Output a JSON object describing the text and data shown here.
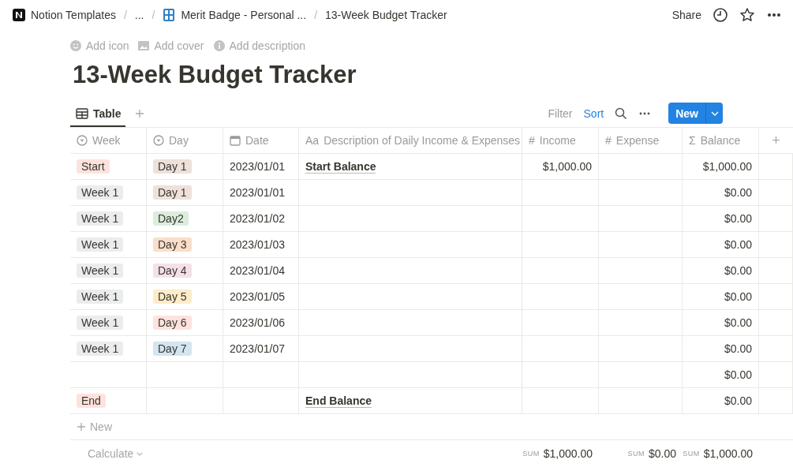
{
  "breadcrumb": {
    "separator": "/",
    "items": [
      {
        "label": "Notion Templates",
        "kind": "logo"
      },
      {
        "label": "...",
        "kind": "plain"
      },
      {
        "label": "Merit Badge - Personal ...",
        "kind": "numbers"
      },
      {
        "label": "13-Week Budget Tracker",
        "kind": "plain"
      }
    ]
  },
  "topbar": {
    "share": "Share"
  },
  "page_actions": [
    {
      "label": "Add icon",
      "kind": "smile"
    },
    {
      "label": "Add cover",
      "kind": "image"
    },
    {
      "label": "Add description",
      "kind": "info"
    }
  ],
  "title": "13-Week Budget Tracker",
  "views": [
    {
      "label": "Table",
      "selected": true
    }
  ],
  "toolbar": {
    "filter": "Filter",
    "sort": "Sort",
    "new": "New"
  },
  "table": {
    "columns": [
      {
        "label": "Week",
        "kind": "select"
      },
      {
        "label": "Day",
        "kind": "select"
      },
      {
        "label": "Date",
        "kind": "date"
      },
      {
        "label": "Description of Daily Income & Expenses",
        "kind": "title",
        "glyph": "Aa"
      },
      {
        "label": "Income",
        "kind": "number",
        "glyph": "#",
        "sum": {
          "prefix": "SUM",
          "value": "$1,000.00"
        }
      },
      {
        "label": "Expense",
        "kind": "number",
        "glyph": "#",
        "sum": {
          "prefix": "SUM",
          "value": "$0.00"
        }
      },
      {
        "label": "Balance",
        "kind": "formula",
        "glyph": "Σ",
        "sum": {
          "prefix": "SUM",
          "value": "$1,000.00"
        }
      }
    ],
    "add_column": "+",
    "rows": [
      {
        "week": {
          "label": "Start",
          "color": "#fde2dd"
        },
        "day": {
          "label": "Day 1",
          "color": "#eee0da"
        },
        "date": "2023/01/01",
        "description": "Start Balance",
        "income": "$1,000.00",
        "expense": "",
        "balance": "$1,000.00"
      },
      {
        "week": {
          "label": "Week 1",
          "color": "#ebeced"
        },
        "day": {
          "label": "Day 1",
          "color": "#eee0da"
        },
        "date": "2023/01/01",
        "description": "",
        "income": "",
        "expense": "",
        "balance": "$0.00"
      },
      {
        "week": {
          "label": "Week 1",
          "color": "#ebeced"
        },
        "day": {
          "label": "Day2",
          "color": "#dbeddb"
        },
        "date": "2023/01/02",
        "description": "",
        "income": "",
        "expense": "",
        "balance": "$0.00"
      },
      {
        "week": {
          "label": "Week 1",
          "color": "#ebeced"
        },
        "day": {
          "label": "Day 3",
          "color": "#fadec9"
        },
        "date": "2023/01/03",
        "description": "",
        "income": "",
        "expense": "",
        "balance": "$0.00"
      },
      {
        "week": {
          "label": "Week 1",
          "color": "#ebeced"
        },
        "day": {
          "label": "Day 4",
          "color": "#f5e0e9"
        },
        "date": "2023/01/04",
        "description": "",
        "income": "",
        "expense": "",
        "balance": "$0.00"
      },
      {
        "week": {
          "label": "Week 1",
          "color": "#ebeced"
        },
        "day": {
          "label": "Day 5",
          "color": "#fdecc8"
        },
        "date": "2023/01/05",
        "description": "",
        "income": "",
        "expense": "",
        "balance": "$0.00"
      },
      {
        "week": {
          "label": "Week 1",
          "color": "#ebeced"
        },
        "day": {
          "label": "Day 6",
          "color": "#ffe2dd"
        },
        "date": "2023/01/06",
        "description": "",
        "income": "",
        "expense": "",
        "balance": "$0.00"
      },
      {
        "week": {
          "label": "Week 1",
          "color": "#ebeced"
        },
        "day": {
          "label": "Day 7",
          "color": "#d3e5ef"
        },
        "date": "2023/01/07",
        "description": "",
        "income": "",
        "expense": "",
        "balance": "$0.00"
      },
      {
        "date": "",
        "description": "",
        "income": "",
        "expense": "",
        "balance": "$0.00"
      },
      {
        "week": {
          "label": "End",
          "color": "#ffe2dd"
        },
        "date": "",
        "description": "End Balance",
        "income": "",
        "expense": "",
        "balance": "$0.00"
      }
    ],
    "new_row": "New",
    "calculate": "Calculate"
  }
}
